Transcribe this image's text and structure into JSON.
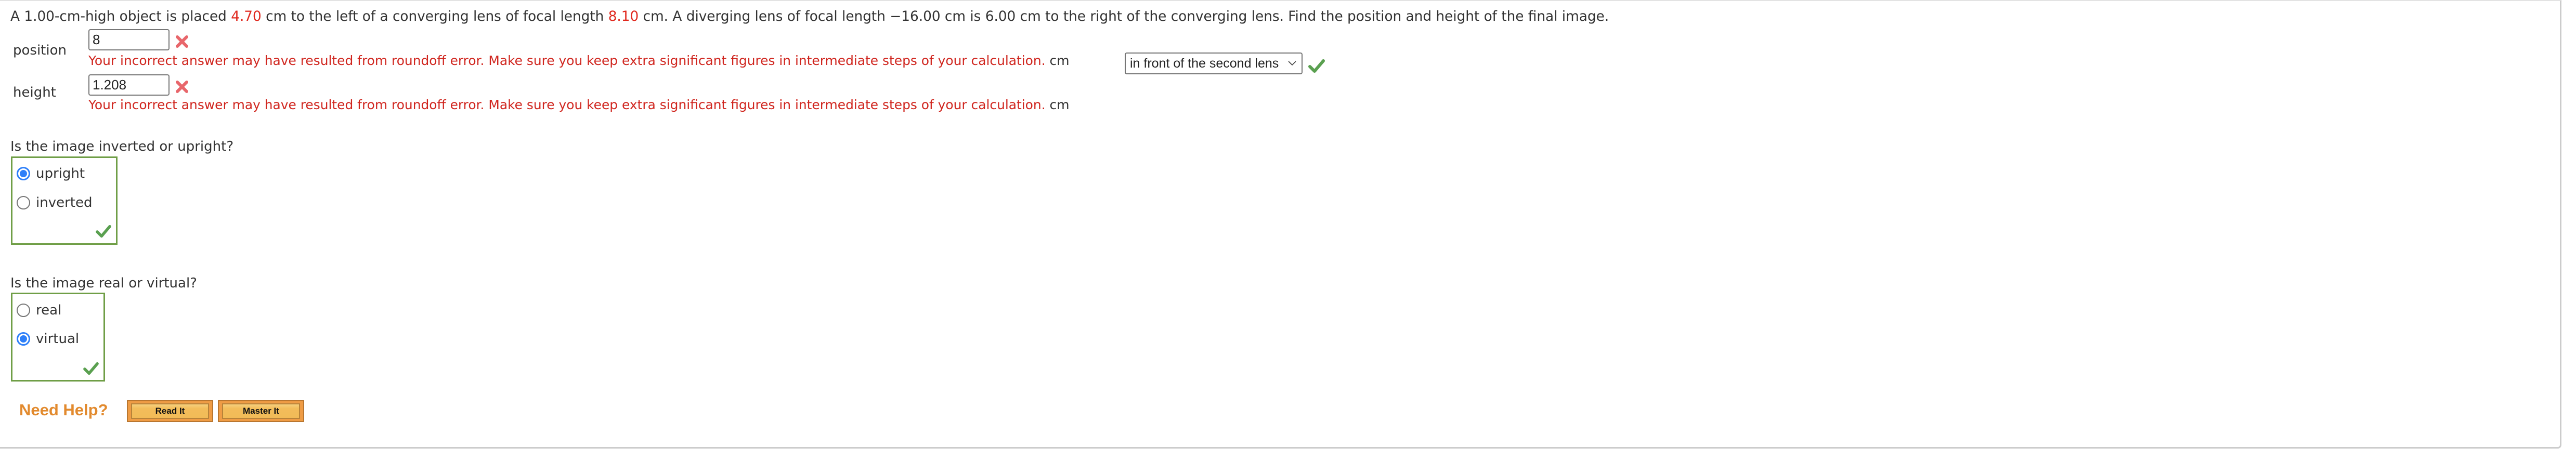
{
  "problem": {
    "prompt_parts": [
      {
        "text": "A 1.00-cm-high object is placed ",
        "highlight": false
      },
      {
        "text": "4.70",
        "highlight": true
      },
      {
        "text": " cm to the left of a converging lens of focal length ",
        "highlight": false
      },
      {
        "text": "8.10",
        "highlight": true
      },
      {
        "text": " cm. A diverging lens of focal length −16.00 cm is 6.00 cm to the right of the converging lens. Find the position and height of the final image.",
        "highlight": false
      }
    ]
  },
  "answers": {
    "position": {
      "label": "position",
      "value": "8",
      "status": "incorrect",
      "feedback": "Your incorrect answer may have resulted from roundoff error. Make sure you keep extra significant figures in intermediate steps of your calculation.",
      "unit": "cm",
      "location_select": {
        "selected": "in front of the second lens",
        "status": "correct"
      }
    },
    "height": {
      "label": "height",
      "value": "1.208",
      "status": "incorrect",
      "feedback": "Your incorrect answer may have resulted from roundoff error. Make sure you keep extra significant figures in intermediate steps of your calculation.",
      "unit": "cm"
    }
  },
  "questions": [
    {
      "prompt": "Is the image inverted or upright?",
      "options": [
        {
          "label": "upright",
          "selected": true
        },
        {
          "label": "inverted",
          "selected": false
        }
      ],
      "status": "correct"
    },
    {
      "prompt": "Is the image real or virtual?",
      "options": [
        {
          "label": "real",
          "selected": false
        },
        {
          "label": "virtual",
          "selected": true
        }
      ],
      "status": "correct"
    }
  ],
  "help": {
    "title": "Need Help?",
    "buttons": [
      {
        "label": "Read It"
      },
      {
        "label": "Master It"
      }
    ]
  },
  "colors": {
    "highlight_red": "#e0281e",
    "feedback_red": "#d0261f",
    "correct_green": "#6f9e46",
    "radio_blue": "#2d7ff9",
    "help_orange": "#e28a2e"
  }
}
